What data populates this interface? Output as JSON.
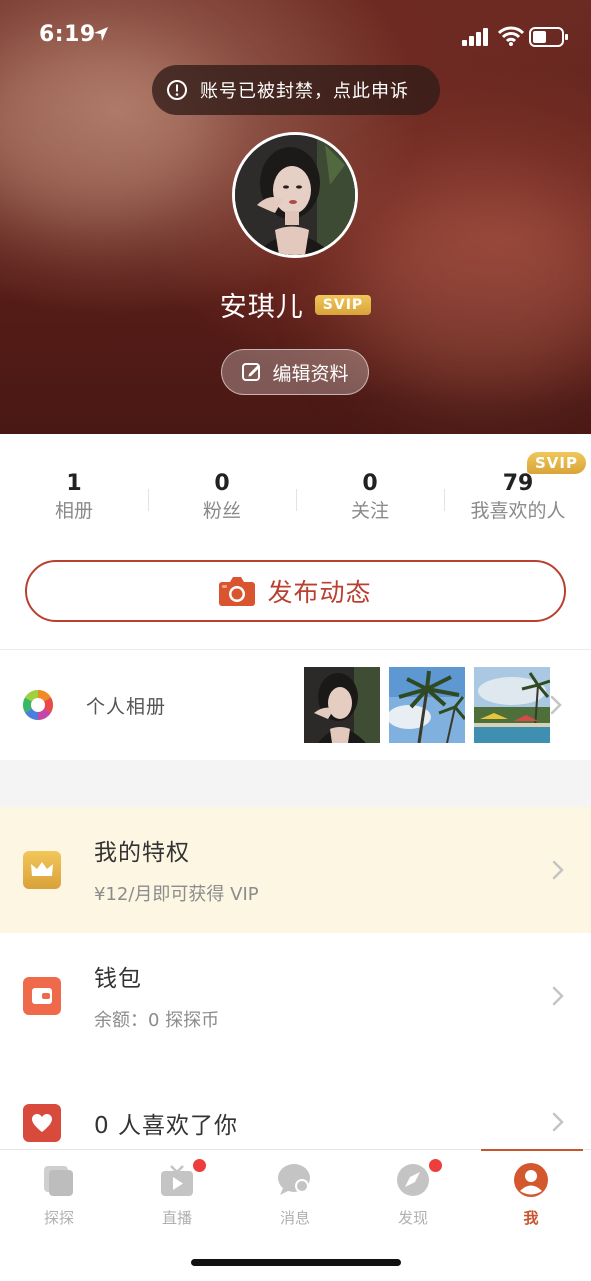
{
  "status_bar": {
    "time": "6:19"
  },
  "header": {
    "ban_notice": "账号已被封禁，点此申诉",
    "name": "安琪儿",
    "vip_badge": "SVIP",
    "edit_label": "编辑资料"
  },
  "stats": [
    {
      "value": "1",
      "label": "相册"
    },
    {
      "value": "0",
      "label": "粉丝"
    },
    {
      "value": "0",
      "label": "关注"
    },
    {
      "value": "79",
      "label": "我喜欢的人"
    }
  ],
  "stats_badge": "SVIP",
  "publish_label": "发布动态",
  "album": {
    "label": "个人相册"
  },
  "menu": {
    "privilege": {
      "title": "我的特权",
      "subtitle": "¥12/月即可获得 VIP"
    },
    "wallet": {
      "title": "钱包",
      "subtitle": "余额：0 探探币"
    },
    "likes": {
      "title": "0 人喜欢了你"
    }
  },
  "tabs": [
    {
      "label": "探探",
      "icon": "cards-icon",
      "badge": false
    },
    {
      "label": "直播",
      "icon": "live-tv-icon",
      "badge": true
    },
    {
      "label": "消息",
      "icon": "chat-bubble-icon",
      "badge": false
    },
    {
      "label": "发现",
      "icon": "compass-icon",
      "badge": true
    },
    {
      "label": "我",
      "icon": "profile-icon",
      "badge": false,
      "active": true
    }
  ],
  "colors": {
    "accent": "#c9552f",
    "publish": "#b94030",
    "vip_gold": "#e0b048",
    "privilege_bg": "#fdf6e3"
  }
}
